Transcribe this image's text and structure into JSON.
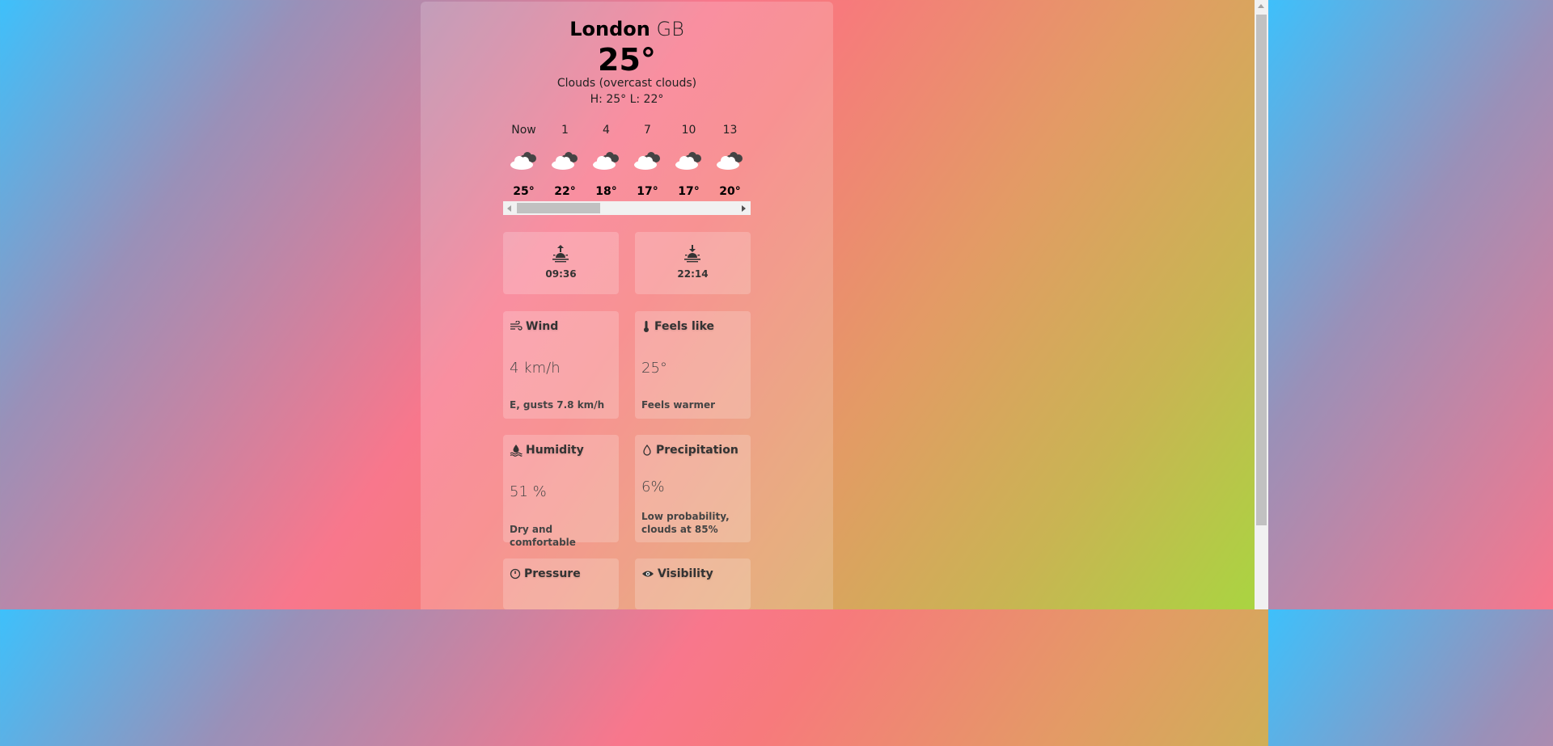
{
  "location": {
    "city": "London",
    "country": "GB"
  },
  "current": {
    "temperature": "25°",
    "description": "Clouds (overcast clouds)",
    "high_low": "H: 25° L: 22°"
  },
  "hourly": [
    {
      "label": "Now",
      "icon": "overcast-clouds-icon",
      "temp": "25°"
    },
    {
      "label": "1",
      "icon": "overcast-clouds-icon",
      "temp": "22°"
    },
    {
      "label": "4",
      "icon": "overcast-clouds-icon",
      "temp": "18°"
    },
    {
      "label": "7",
      "icon": "overcast-clouds-icon",
      "temp": "17°"
    },
    {
      "label": "10",
      "icon": "overcast-clouds-icon",
      "temp": "17°"
    },
    {
      "label": "13",
      "icon": "overcast-clouds-icon",
      "temp": "20°"
    }
  ],
  "sun": {
    "sunrise": {
      "icon": "sunrise-icon",
      "time": "09:36"
    },
    "sunset": {
      "icon": "sunset-icon",
      "time": "22:14"
    }
  },
  "details": {
    "wind": {
      "icon": "wind-icon",
      "title": "Wind",
      "value": "4 km/h",
      "note": "E, gusts 7.8 km/h"
    },
    "feels_like": {
      "icon": "thermometer-icon",
      "title": "Feels like",
      "value": "25°",
      "note": "Feels warmer"
    },
    "humidity": {
      "icon": "humidity-icon",
      "title": "Humidity",
      "value": "51 %",
      "note": "Dry and comfortable"
    },
    "precipitation": {
      "icon": "raindrop-icon",
      "title": "Precipitation",
      "value": "6%",
      "note": "Low probability, clouds at 85%"
    },
    "pressure": {
      "icon": "gauge-icon",
      "title": "Pressure"
    },
    "visibility": {
      "icon": "eye-icon",
      "title": "Visibility"
    }
  },
  "colors": {
    "gradient_start": "#3ec0fb",
    "gradient_mid": "#f8778c",
    "gradient_end": "#a8d640"
  }
}
